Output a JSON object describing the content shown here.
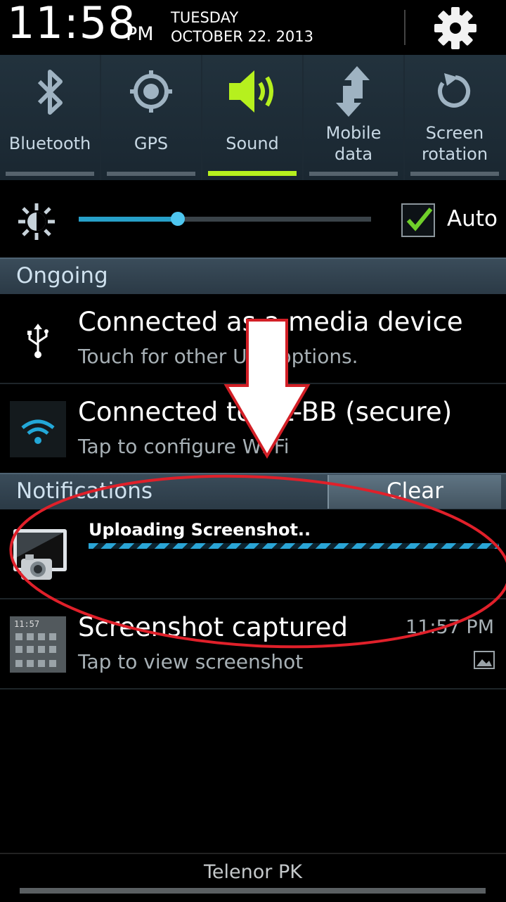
{
  "status": {
    "time": "11:58",
    "ampm": "PM",
    "day": "TUESDAY",
    "date": "OCTOBER 22. 2013"
  },
  "toggles": [
    {
      "label": "Bluetooth",
      "icon": "bluetooth-icon",
      "active": false
    },
    {
      "label": "GPS",
      "icon": "gps-icon",
      "active": false
    },
    {
      "label": "Sound",
      "icon": "sound-icon",
      "active": true
    },
    {
      "label1": "Mobile",
      "label2": "data",
      "icon": "mobile-data-icon",
      "active": false
    },
    {
      "label1": "Screen",
      "label2": "rotation",
      "icon": "screen-rotation-icon",
      "active": false
    }
  ],
  "brightness": {
    "level": 0.34,
    "auto_label": "Auto",
    "auto_checked": true
  },
  "ongoing": {
    "header": "Ongoing",
    "usb": {
      "title": "Connected as a media device",
      "sub": "Touch for other USB options."
    },
    "wifi": {
      "title": "Connected to CL-BB (secure)",
      "sub": "Tap to configure Wi-Fi"
    }
  },
  "notifications": {
    "header": "Notifications",
    "clear_label": "Clear",
    "upload": {
      "title": "Uploading Screenshot.."
    },
    "screenshot": {
      "title": "Screenshot captured",
      "sub": "Tap to view screenshot",
      "time": "11:57 PM"
    }
  },
  "carrier": "Telenor PK",
  "colors": {
    "accent": "#b6f01e",
    "blue": "#27a0c9",
    "annotation_red": "#e0202a",
    "arrow": "#ffffff"
  }
}
